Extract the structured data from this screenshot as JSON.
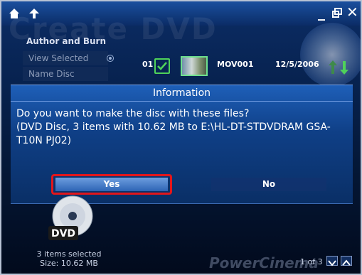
{
  "watermark": "Create DVD",
  "menu": {
    "title": "Author and Burn",
    "view_selected": "View Selected",
    "name_disc": "Name Disc"
  },
  "file_row": {
    "index": "01",
    "name": "MOV001",
    "date": "12/5/2006"
  },
  "dialog": {
    "title": "Information",
    "line1": "Do you want to make the disc with these files?",
    "line2": "(DVD Disc, 3 items with 10.62 MB to E:\\HL-DT-STDVDRAM GSA-",
    "line3": "T10N PJ02)",
    "yes_label": "Yes",
    "no_label": "No"
  },
  "status": {
    "items": "3 items selected",
    "size": "Size: 10.62 MB",
    "disc_label": "DVD"
  },
  "pager": {
    "text": "1 of 3"
  },
  "brand": "PowerCinema",
  "colors": {
    "highlight": "#e3161b",
    "accent": "#4fd25a"
  }
}
